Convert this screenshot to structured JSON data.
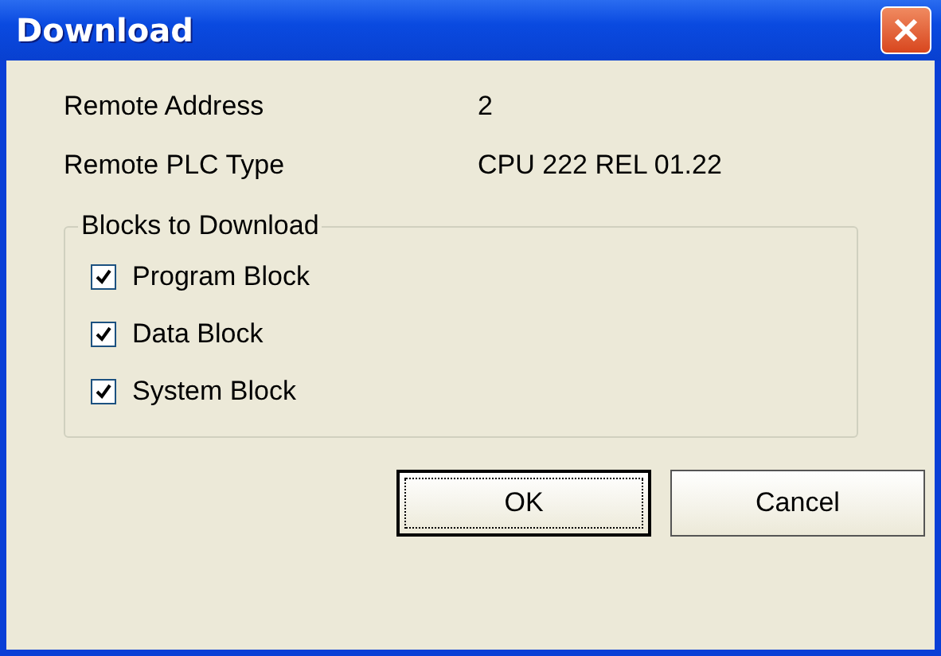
{
  "window": {
    "title": "Download"
  },
  "fields": [
    {
      "label": "Remote Address",
      "value": "2"
    },
    {
      "label": "Remote PLC Type",
      "value": "CPU 222 REL 01.22"
    }
  ],
  "group": {
    "title": "Blocks to Download",
    "items": [
      {
        "label": "Program Block",
        "checked": true
      },
      {
        "label": "Data Block",
        "checked": true
      },
      {
        "label": "System Block",
        "checked": true
      }
    ]
  },
  "buttons": [
    {
      "label": "OK",
      "default": true
    },
    {
      "label": "Cancel",
      "default": false
    }
  ]
}
